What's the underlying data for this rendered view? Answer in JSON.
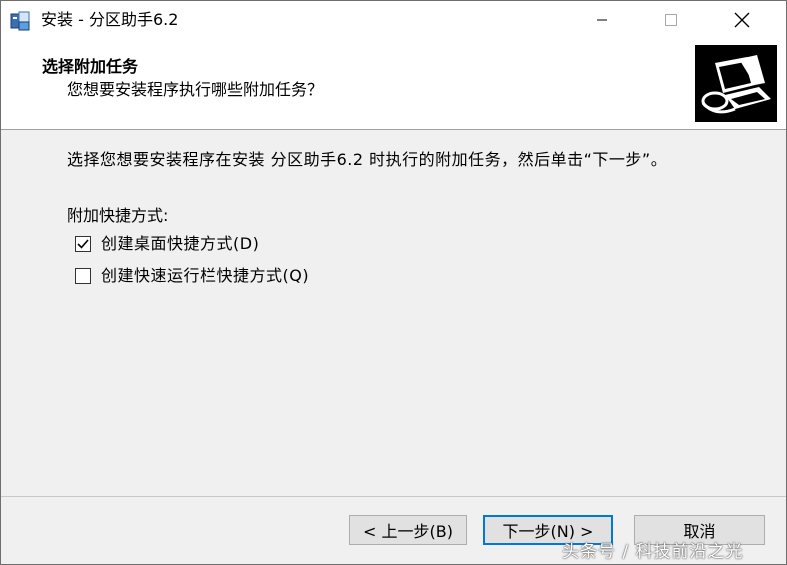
{
  "window": {
    "title": "安装 - 分区助手6.2"
  },
  "header": {
    "title": "选择附加任务",
    "subtitle": "您想要安装程序执行哪些附加任务？"
  },
  "content": {
    "description": "选择您想要安装程序在安装 分区助手6.2 时执行的附加任务，然后单击“下一步”。",
    "group_label": "附加快捷方式:",
    "options": [
      {
        "label": "创建桌面快捷方式(D)",
        "checked": true
      },
      {
        "label": "创建快速运行栏快捷方式(Q)",
        "checked": false
      }
    ]
  },
  "buttons": {
    "back": "< 上一步(B)",
    "next": "下一步(N) >",
    "cancel": "取消"
  },
  "watermark": "头条号 / 科技前沿之光",
  "colors": {
    "focus_border": "#0078d7",
    "window_bg": "#f0f0f0",
    "header_bg": "#ffffff"
  }
}
